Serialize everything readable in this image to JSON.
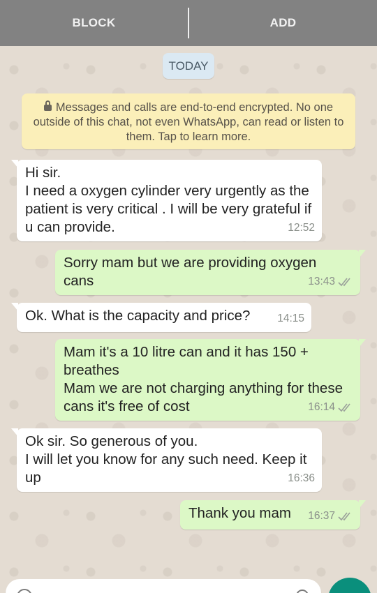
{
  "topbar": {
    "block_label": "BLOCK",
    "add_label": "ADD"
  },
  "date_chip": "TODAY",
  "encryption_notice": "Messages and calls are end-to-end encrypted. No one outside of this chat, not even WhatsApp, can read or listen to them. Tap to learn more.",
  "messages": [
    {
      "direction": "in",
      "text": "Hi sir.\nI need a oxygen cylinder very urgently as the patient is very critical . I will be very grateful if u can provide.",
      "time": "12:52"
    },
    {
      "direction": "out",
      "text": "Sorry mam but we are providing oxygen cans",
      "time": "13:43",
      "status": "read"
    },
    {
      "direction": "in",
      "text": "Ok. What is the capacity and price?",
      "time": "14:15"
    },
    {
      "direction": "out",
      "text": "Mam it's a 10 litre can and it has 150 + breathes\nMam we are not charging anything for these cans it's free of cost",
      "time": "16:14",
      "status": "read"
    },
    {
      "direction": "in",
      "text": "Ok sir. So generous of you.\nI will let you know for any such need. Keep it up",
      "time": "16:36"
    },
    {
      "direction": "out",
      "text": "Thank you mam",
      "time": "16:37",
      "status": "read"
    }
  ],
  "icons": {
    "lock": "lock-icon",
    "read_receipt": "double-check-icon",
    "emoji": "emoji-icon",
    "attach": "attach-icon",
    "mic": "mic-icon"
  },
  "colors": {
    "topbar": "#828282",
    "incoming_bubble": "#ffffff",
    "outgoing_bubble": "#dcf8c6",
    "notice": "#fbefb9",
    "date_chip": "#dbe9f3",
    "fab": "#0a8f7c"
  }
}
